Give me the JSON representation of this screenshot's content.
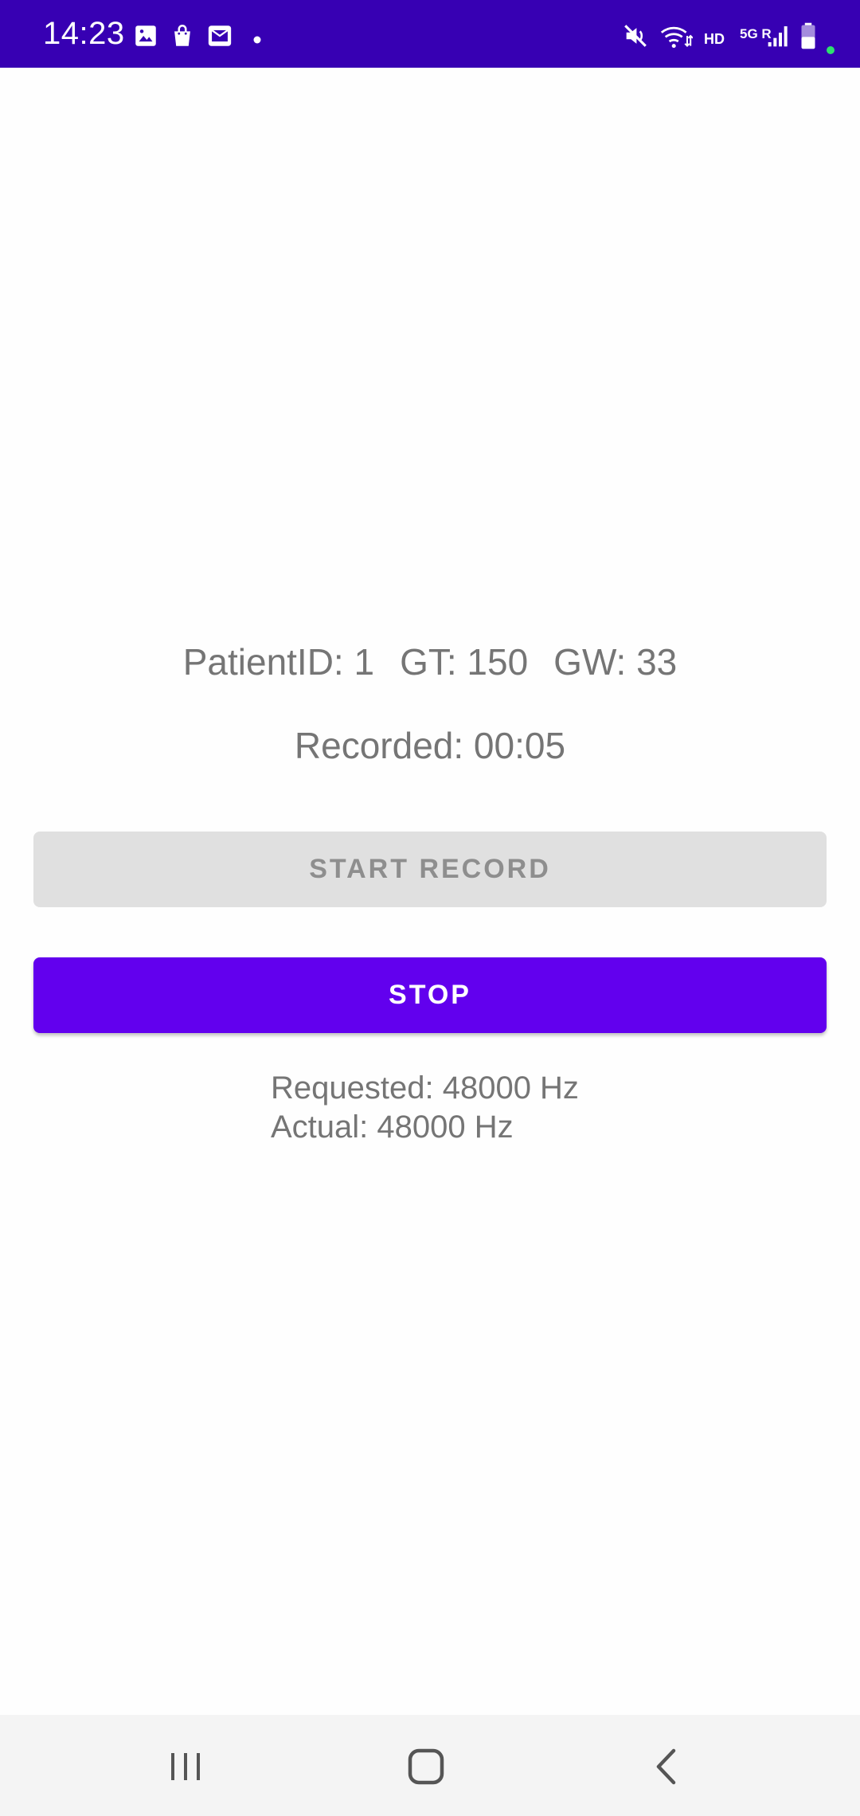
{
  "status_bar": {
    "time": "14:23",
    "hd_label": "HD",
    "network_label": "5G R",
    "notification_icons": [
      "gallery-icon",
      "shopping-bag-icon",
      "email-icon",
      "dot-icon"
    ],
    "system_icons": [
      "mute-icon",
      "wifi-icon",
      "signal-icon",
      "battery-icon"
    ],
    "background_color": "#3700b3"
  },
  "main": {
    "patient_id": "PatientID: 1",
    "gt": "GT: 150",
    "gw": "GW: 33",
    "recorded": "Recorded: 00:05",
    "start_button_label": "START RECORD",
    "start_button_enabled": false,
    "stop_button_label": "STOP",
    "stop_button_color": "#6200ee",
    "requested_rate": "Requested: 48000 Hz",
    "actual_rate": "Actual: 48000 Hz"
  },
  "nav_bar": {
    "buttons": [
      "recents-icon",
      "home-icon",
      "back-icon"
    ]
  }
}
